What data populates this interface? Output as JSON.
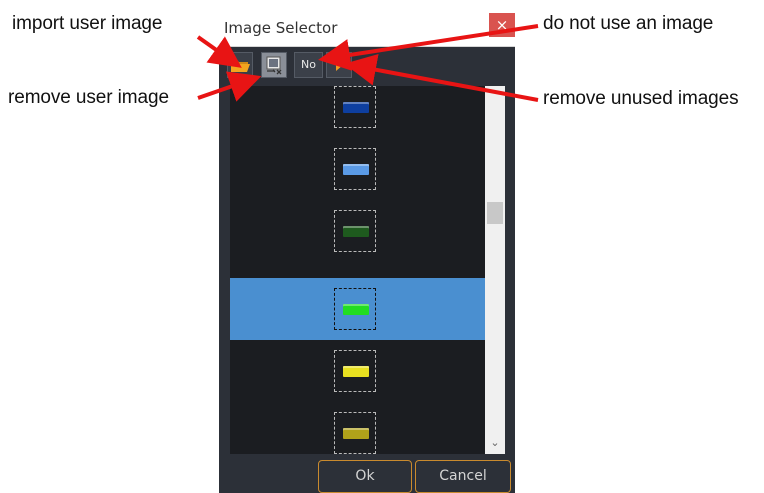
{
  "annotations": {
    "import_user_image": "import user image",
    "remove_user_image": "remove user image",
    "do_not_use_image": "do not use an image",
    "remove_unused_images": "remove unused images"
  },
  "dialog": {
    "title": "Image Selector",
    "close_glyph": "×",
    "toolbar": {
      "import_icon": "folder-open-icon",
      "remove_user_icon": "image-delete-icon",
      "no_label": "No",
      "remove_unused_icon": "play-arrow-icon"
    },
    "items": [
      {
        "name": "dark-blue",
        "color": "#0e3fa0"
      },
      {
        "name": "light-blue",
        "color": "#5a9ae6"
      },
      {
        "name": "dark-green",
        "color": "#1e5a1e"
      },
      {
        "name": "bright-green",
        "color": "#22dd22",
        "selected": true
      },
      {
        "name": "yellow",
        "color": "#e8e020"
      },
      {
        "name": "olive-yellow",
        "color": "#b0a21a"
      }
    ],
    "scroll_up_glyph": "⌃",
    "scroll_down_glyph": "⌄",
    "ok_label": "Ok",
    "cancel_label": "Cancel"
  },
  "colors": {
    "arrow": "#e81414",
    "dialog_bg": "#2c3038",
    "list_bg": "#1b1d21",
    "selection": "#4a8fd0",
    "button_border": "#c98a2e"
  }
}
